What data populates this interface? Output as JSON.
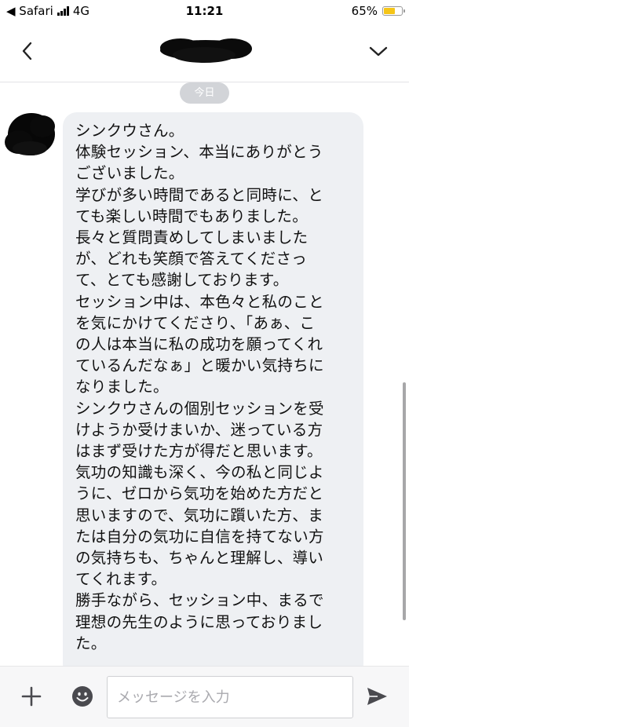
{
  "status_bar": {
    "back_app": "◀ Safari",
    "network": "4G",
    "time": "11:21",
    "battery": "65%",
    "battery_level": 0.65,
    "battery_color": "#f5c518"
  },
  "header": {
    "back_icon": "chevron-left-icon",
    "dropdown_icon": "chevron-down-icon"
  },
  "chat": {
    "date_label": "今日",
    "message_text": "シンクウさん。\n体験セッション、本当にありがとう\nございました。\n学びが多い時間であると同時に、と\nても楽しい時間でもありました。\n長々と質問責めしてしまいました\nが、どれも笑顔で答えてくださっ\nて、とても感謝しております。\nセッション中は、本色々と私のこと\nを気にかけてくださり、「あぁ、こ\nの人は本当に私の成功を願ってくれ\nているんだなぁ」と暖かい気持ちに\nなりました。\nシンクウさんの個別セッションを受\nけようか受けまいか、迷っている方\nはまず受けた方が得だと思います。\n気功の知識も深く、今の私と同じよ\nうに、ゼロから気功を始めた方だと\n思いますので、気功に躓いた方、ま\nたは自分の気功に自信を持てない方\nの気持ちも、ちゃんと理解し、導い\nてくれます。\n勝手ながら、セッション中、まるで\n理想の先生のように思っておりまし\nた。"
  },
  "input_bar": {
    "placeholder": "メッセージを入力",
    "value": "",
    "plus_icon": "plus-icon",
    "emoji_icon": "emoji-icon",
    "send_icon": "send-icon"
  }
}
